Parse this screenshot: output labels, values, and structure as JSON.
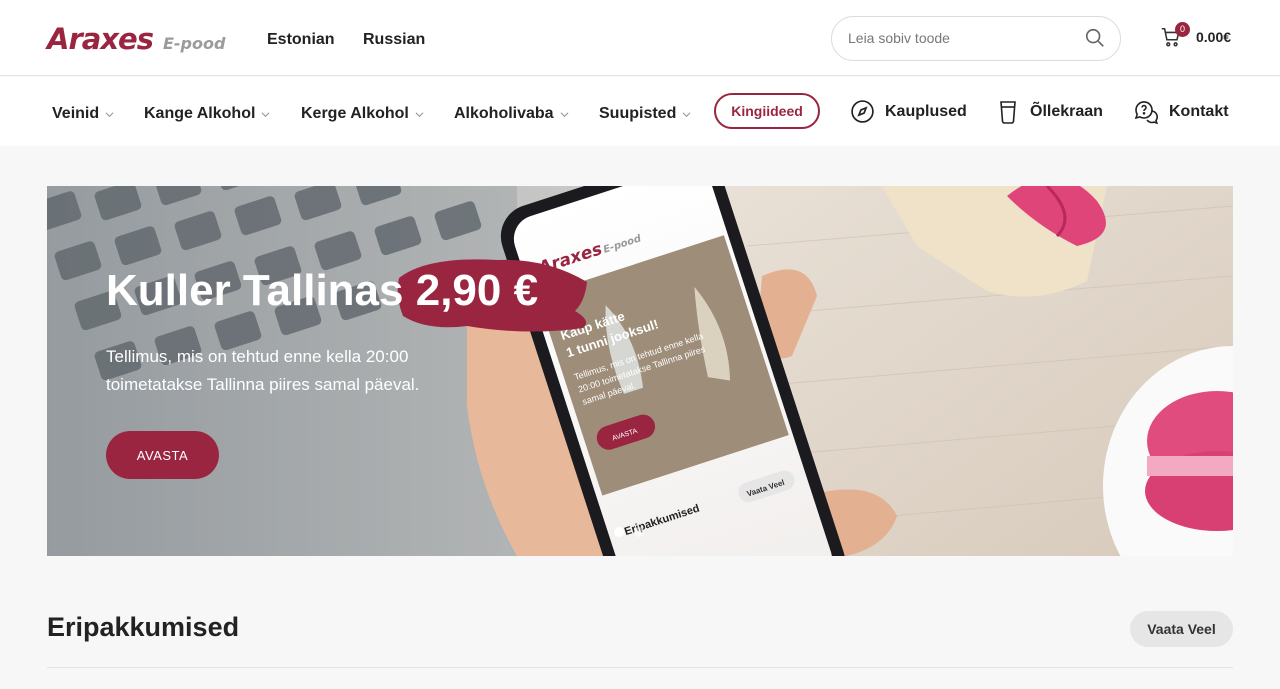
{
  "header": {
    "logo_main": "Araxes",
    "logo_sub": "E-pood",
    "languages": [
      "Estonian",
      "Russian"
    ],
    "search_placeholder": "Leia sobiv toode",
    "cart_count": "0",
    "cart_total": "0.00€"
  },
  "nav": {
    "items": [
      "Veinid",
      "Kange Alkohol",
      "Kerge Alkohol",
      "Alkoholivaba",
      "Suupisted"
    ],
    "gift_label": "Kingiideed",
    "stores_label": "Kauplused",
    "beer_label": "Õllekraan",
    "contact_label": "Kontakt"
  },
  "hero": {
    "title_part1": "Kuller Tallinas ",
    "title_price": "2,90 €",
    "description": "Tellimus, mis on tehtud enne kella 20:00 toimetatakse Tallinna piires samal päeval.",
    "button_label": "AVASTA",
    "slide_count": 2,
    "active_slide": 1
  },
  "phone_screen": {
    "logo_main": "Araxes",
    "logo_sub": "E-pood",
    "promo_line1": "Kaup kätte",
    "promo_line2": "1 tunni jooksul!",
    "promo_text_line1": "Tellimus, mis on tehtud enne kella",
    "promo_text_line2": "20:00 toimetatakse Tallinna piires",
    "promo_text_line3": "samal päeval.",
    "button_label": "AVASTA",
    "section_label": "Eripakkumised",
    "more_label": "Vaata Veel"
  },
  "section": {
    "title": "Eripakkumised",
    "more_label": "Vaata Veel"
  },
  "colors": {
    "brand": "#9a2540",
    "background": "#f7f7f7"
  }
}
